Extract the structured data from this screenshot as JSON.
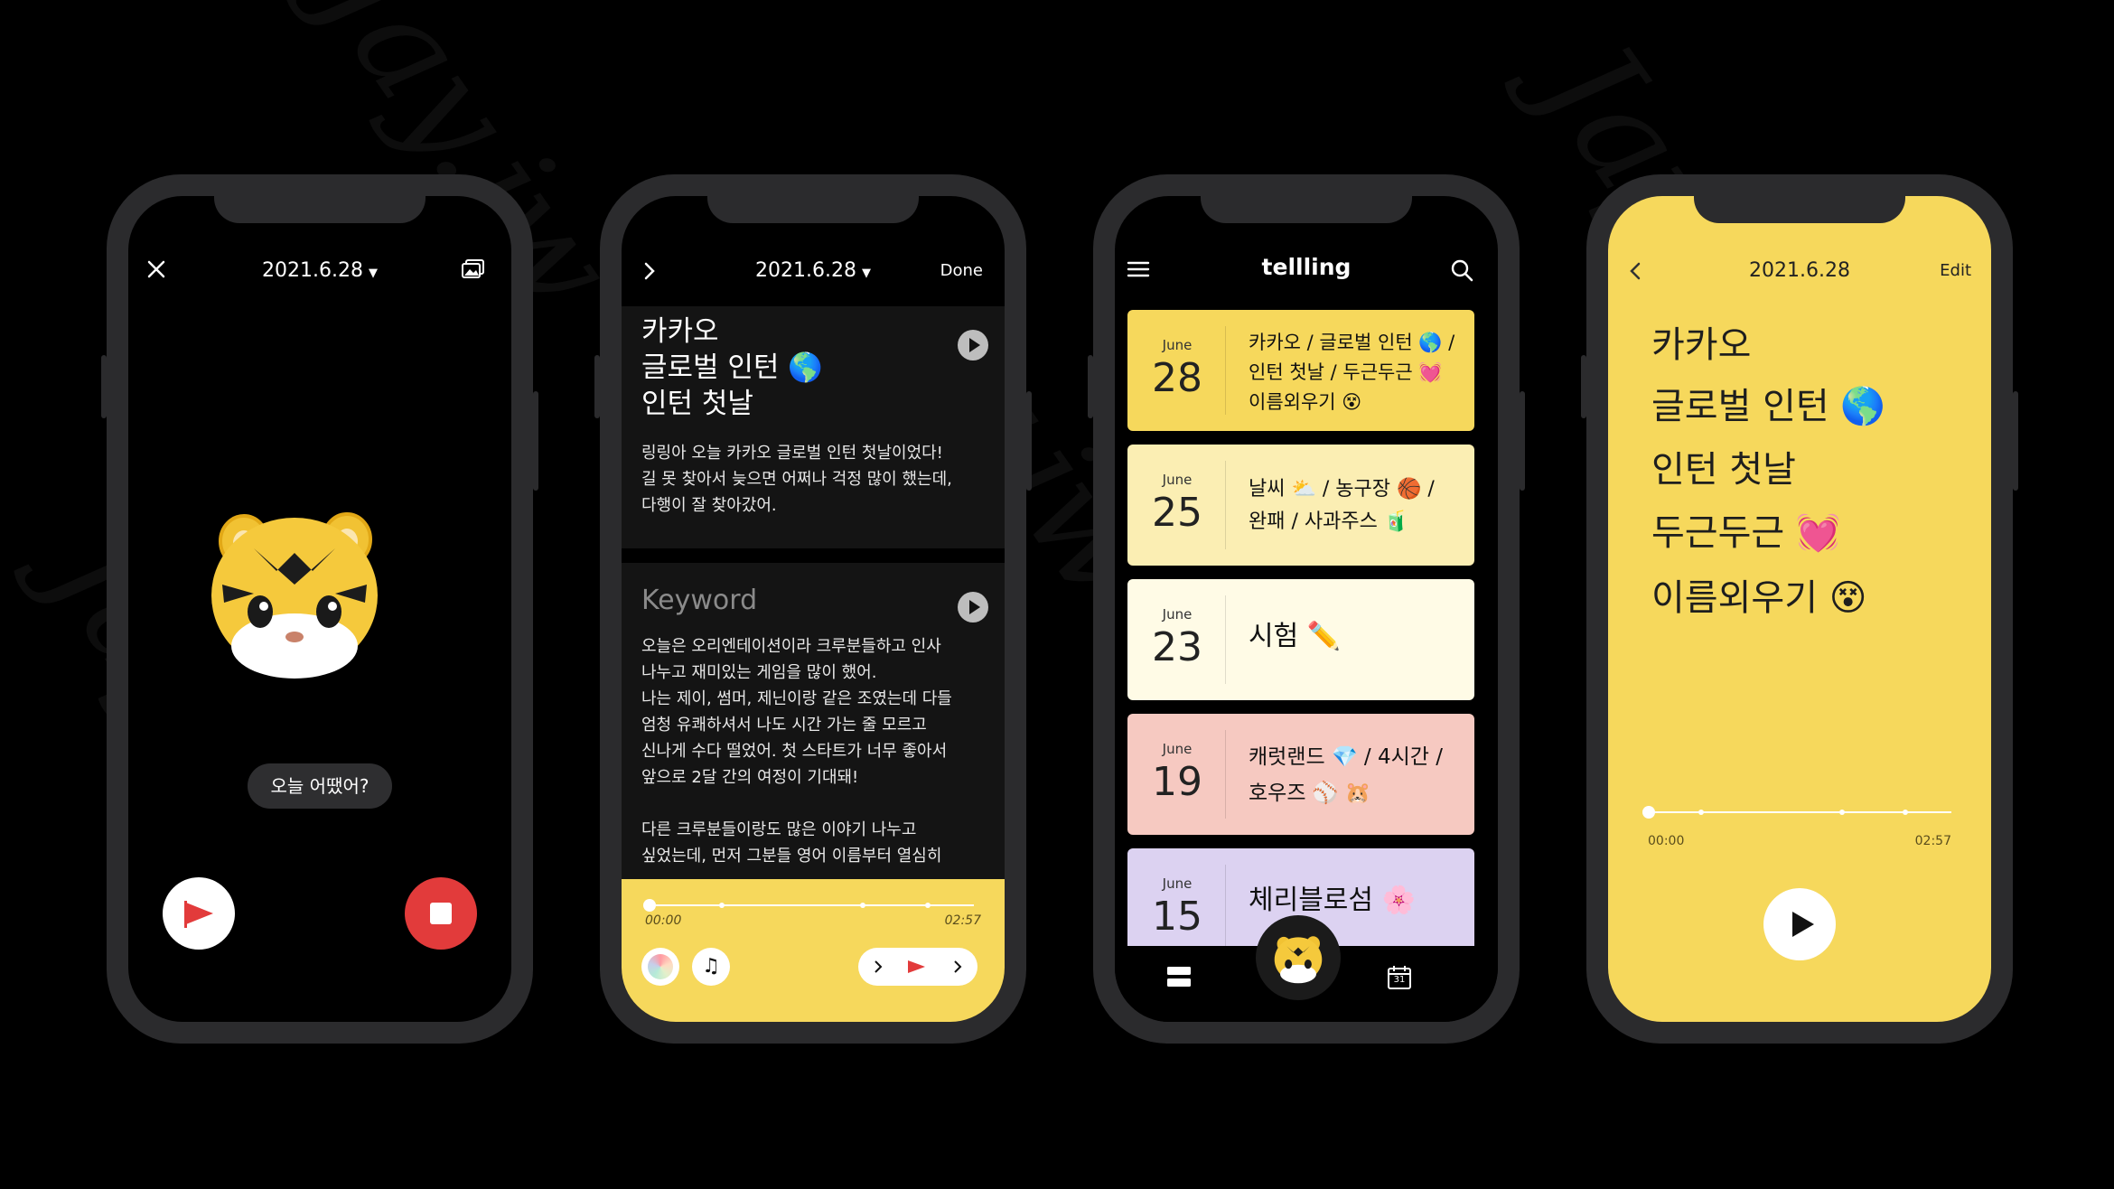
{
  "watermark": "Jay.jw",
  "colors": {
    "background": "#000000",
    "yellow": "#f6d85c",
    "record_red": "#e23b3b",
    "entry_colors": [
      "#f6d85c",
      "#fbeeb3",
      "#fffbe6",
      "#f6c9c1",
      "#dcd2f1"
    ]
  },
  "screen1": {
    "date": "2021.6.28",
    "close_icon": "close-icon",
    "gallery_icon": "gallery-icon",
    "avatar": "tiger-memoji",
    "prompt": "오늘 어땠어?",
    "flag_button_icon": "flag-icon",
    "stop_button_icon": "stop-icon"
  },
  "screen2": {
    "back_icon": "chevron-right-icon",
    "date": "2021.6.28",
    "done_label": "Done",
    "title_lines": [
      "카카오",
      "글로벌 인턴 🌎",
      "인턴 첫날"
    ],
    "summary_lines": [
      "링링아 오늘 카카오 글로벌 인턴 첫날이었다!",
      "길 못 찾아서 늦으면 어쩌나 걱정 많이 했는데,",
      "다행이 잘 찾아갔어."
    ],
    "keyword_label": "Keyword",
    "body_lines": [
      "오늘은 오리엔테이션이라 크루분들하고 인사",
      "나누고 재미있는 게임을 많이 했어.",
      "나는 제이, 썸머, 제닌이랑 같은 조였는데 다들",
      "엄청 유쾌하셔서 나도 시간 가는 줄 모르고",
      "신나게 수다 떨었어. 첫 스타트가 너무 좋아서",
      "앞으로 2달 간의 여정이 기대돼!",
      "",
      "다른 크루분들이랑도 많은 이야기 나누고",
      "싶었는데, 먼저 그분들 영어 이름부터 열심히"
    ],
    "progress": 0.0,
    "time_start": "00:00",
    "time_end": "02:57"
  },
  "screen3": {
    "menu_icon": "menu-icon",
    "app_title": "tellling",
    "search_icon": "search-icon",
    "entries": [
      {
        "month": "June",
        "day": "28",
        "lines": [
          "카카오 / 글로벌 인턴 🌎 /",
          "인턴 첫날 / 두근두근 💓",
          "이름외우기 😵"
        ]
      },
      {
        "month": "June",
        "day": "25",
        "lines": [
          "날씨 ⛅ / 농구장 🏀 /",
          "완패 / 사과주스 🧃"
        ]
      },
      {
        "month": "June",
        "day": "23",
        "lines": [
          "시험 ✏️"
        ]
      },
      {
        "month": "June",
        "day": "19",
        "lines": [
          "캐럿랜드 💎 / 4시간 /",
          "호우즈 ⚾ 🐹"
        ]
      },
      {
        "month": "June",
        "day": "15",
        "lines": [
          "체리블로섬 🌸"
        ]
      }
    ],
    "tab_list_icon": "list-icon",
    "tab_avatar": "tiger-memoji",
    "tab_calendar_icon": "calendar-icon",
    "calendar_day": "31"
  },
  "screen4": {
    "back_icon": "chevron-left-icon",
    "date": "2021.6.28",
    "edit_label": "Edit",
    "lines": [
      "카카오",
      "글로벌 인턴 🌎",
      "인턴 첫날",
      "두근두근 💓",
      "이름외우기 😵"
    ],
    "progress": 0.0,
    "time_start": "00:00",
    "time_end": "02:57",
    "play_icon": "play-icon"
  }
}
